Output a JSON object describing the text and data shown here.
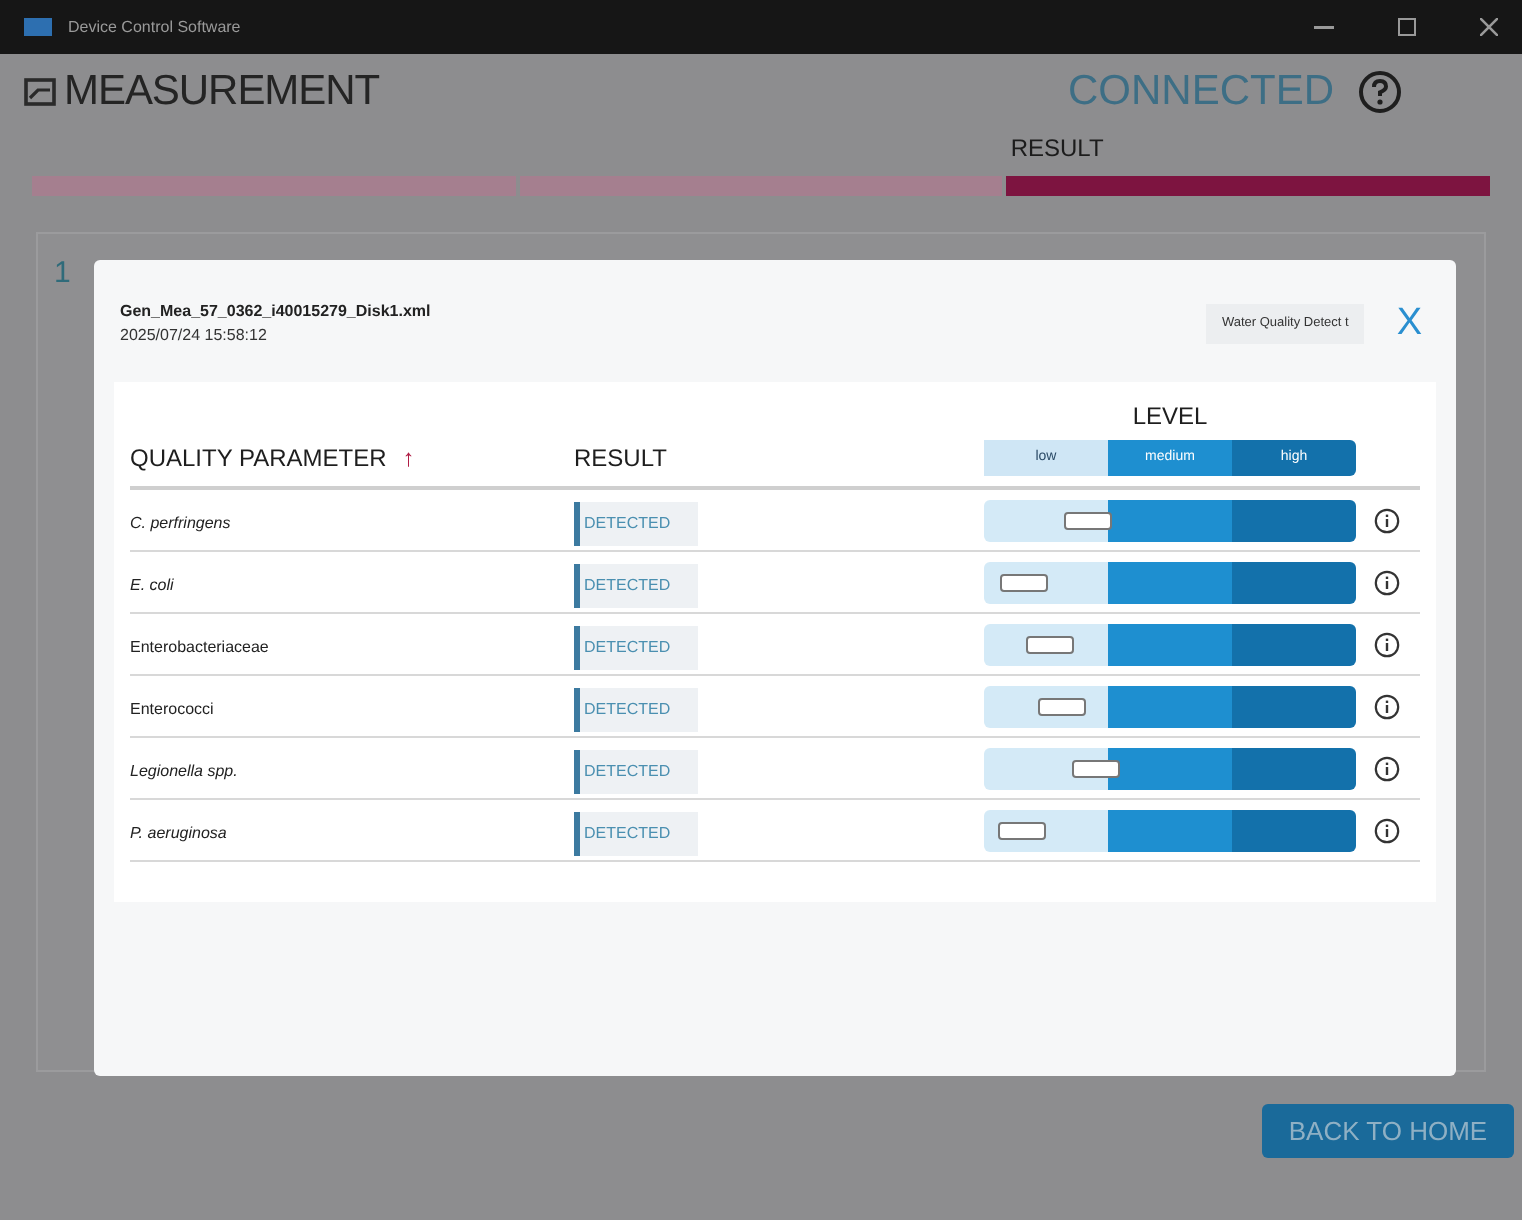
{
  "window": {
    "title": "Device Control Software"
  },
  "header": {
    "title": "MEASUREMENT",
    "status": "CONNECTED"
  },
  "steps": [
    {
      "selected": false
    },
    {
      "selected": false
    },
    {
      "label": "RESULT",
      "selected": true
    }
  ],
  "background_panel": {
    "number": "1"
  },
  "dialog": {
    "file": "Gen_Mea_57_0362_i40015279_Disk1.xml",
    "timestamp": "2025/07/24 15:58:12",
    "tag": "Water Quality Detect t",
    "close": "X",
    "columns": {
      "parameter": "QUALITY PARAMETER",
      "sort_mark": "↑",
      "result": "RESULT",
      "level": "LEVEL"
    },
    "level_scale": [
      "low",
      "medium",
      "high"
    ],
    "rows": [
      {
        "parameter": "C. perfringens",
        "italic": true,
        "result": "DETECTED",
        "level": 0.28
      },
      {
        "parameter": "E. coli",
        "italic": true,
        "result": "DETECTED",
        "level": 0.11
      },
      {
        "parameter": "Enterobacteriaceae",
        "italic": false,
        "result": "DETECTED",
        "level": 0.18
      },
      {
        "parameter": "Enterococci",
        "italic": false,
        "result": "DETECTED",
        "level": 0.21
      },
      {
        "parameter": "Legionella spp.",
        "italic": true,
        "result": "DETECTED",
        "level": 0.3
      },
      {
        "parameter": "P. aeruginosa",
        "italic": true,
        "result": "DETECTED",
        "level": 0.1
      }
    ]
  },
  "footer": {
    "button": "BACK TO HOME"
  }
}
